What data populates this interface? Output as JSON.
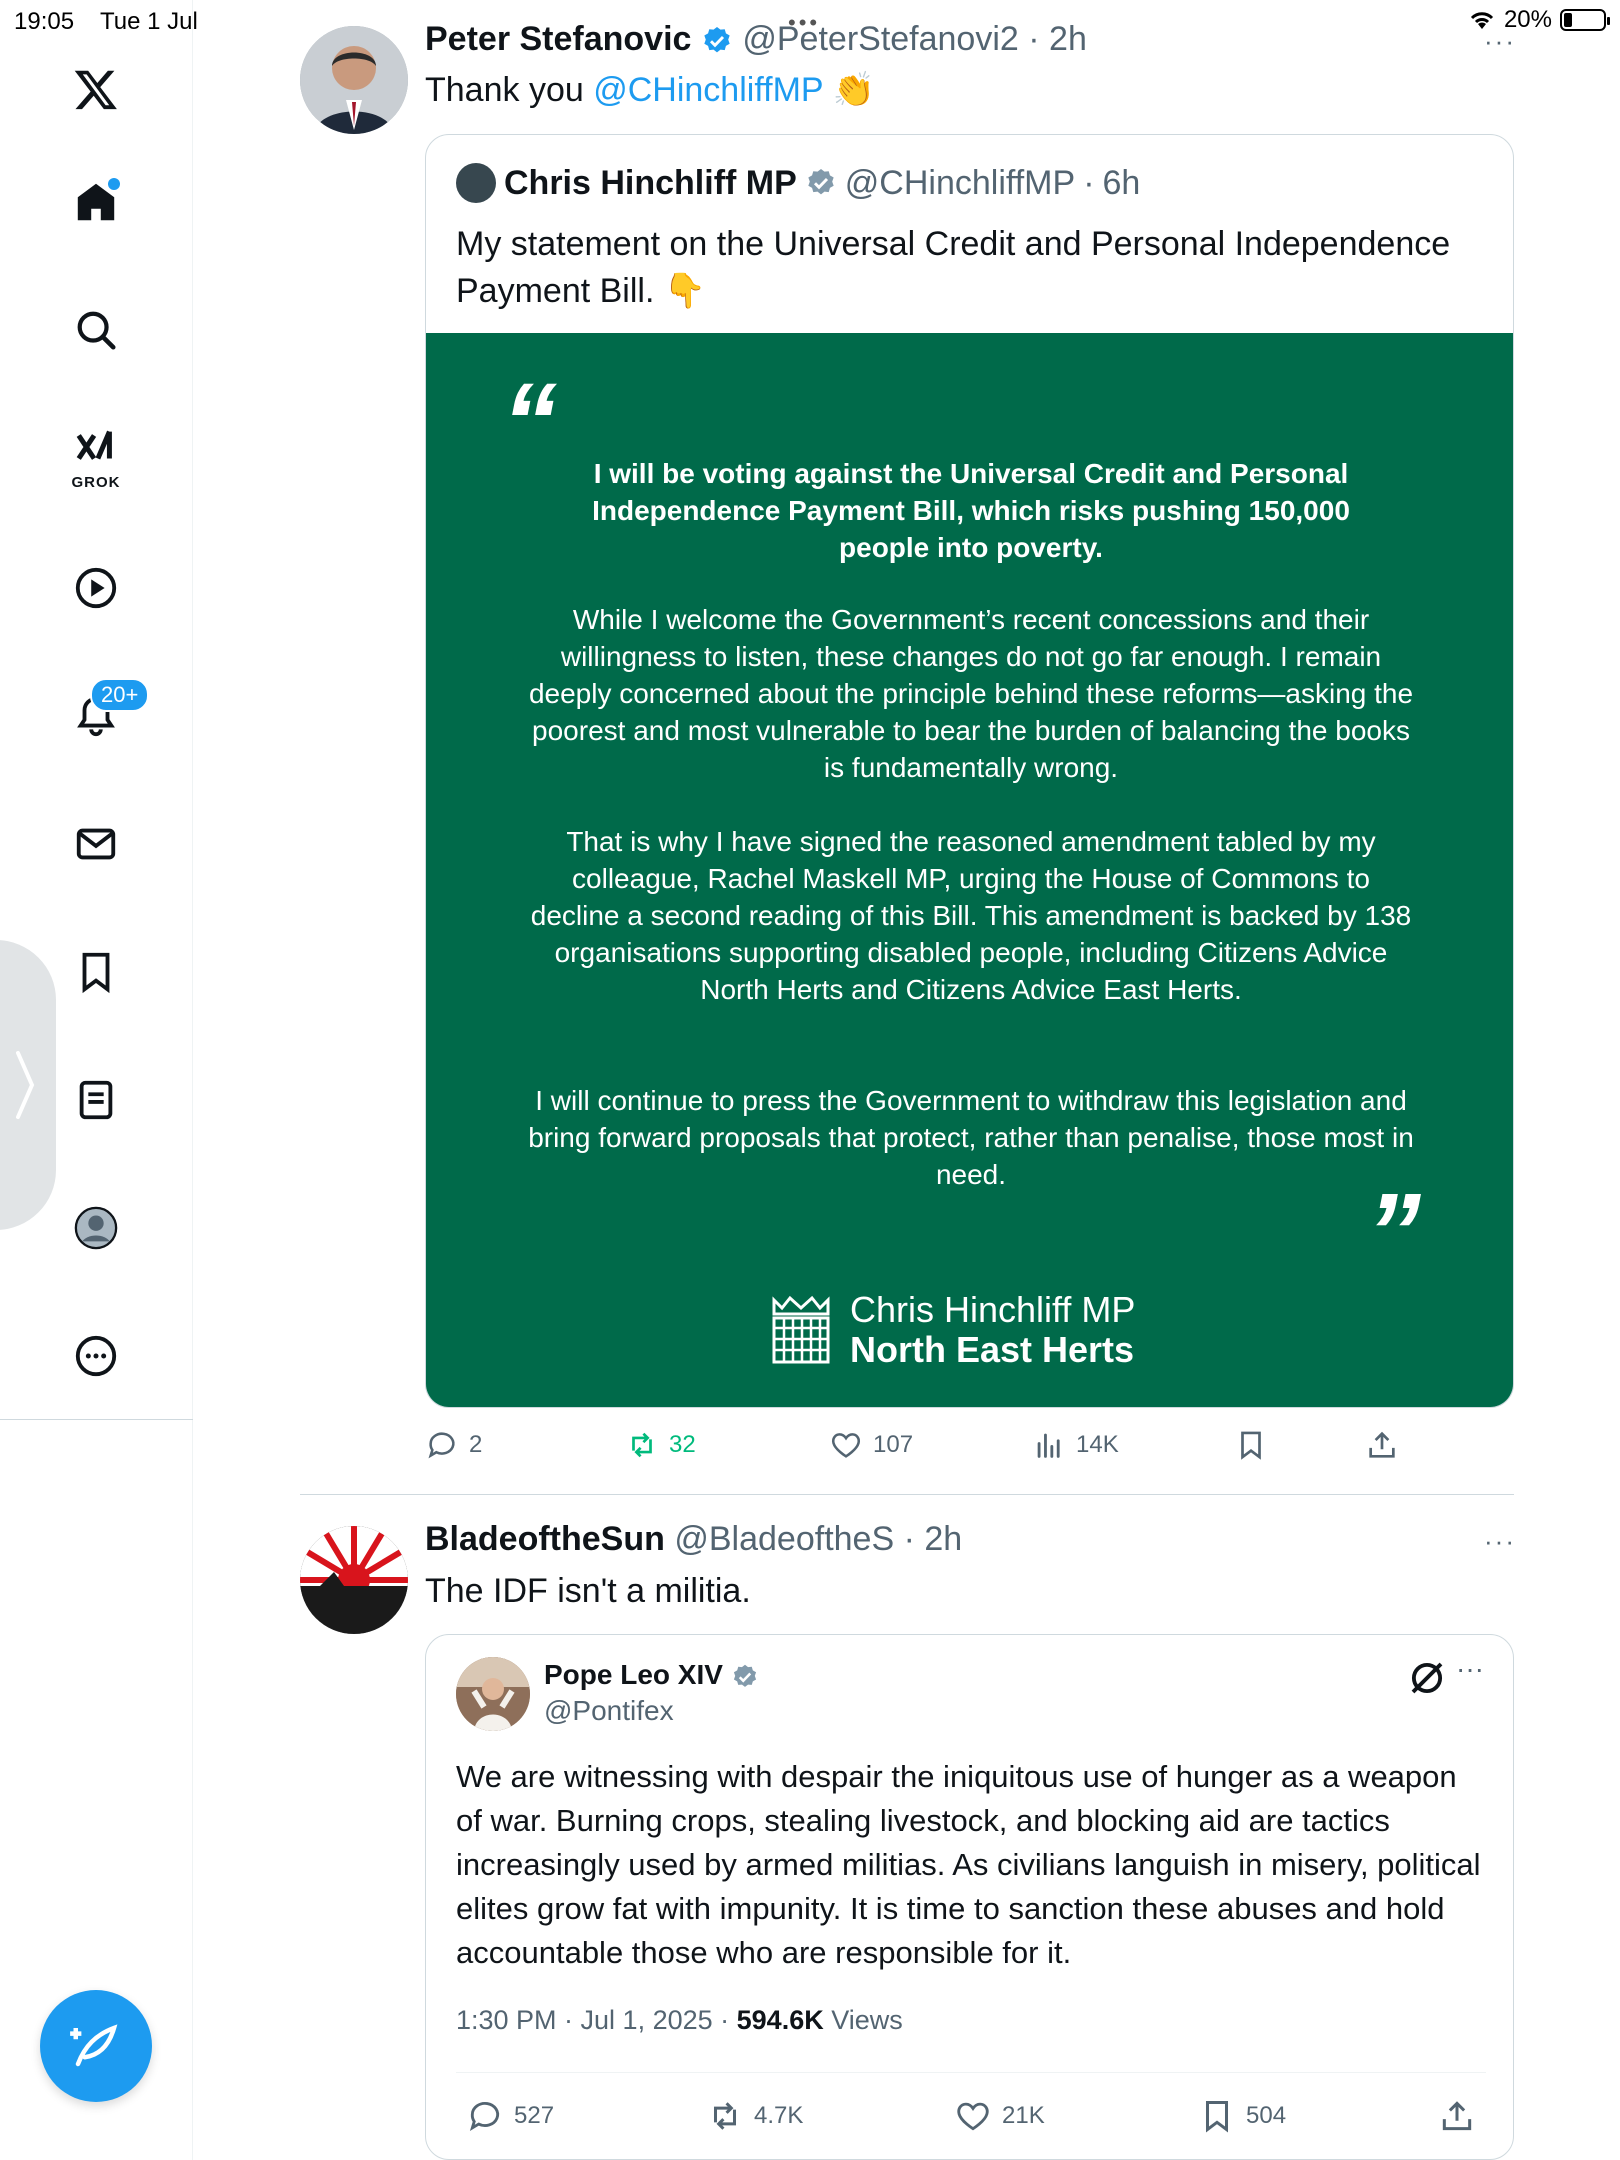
{
  "status_bar": {
    "time": "19:05",
    "date": "Tue 1 Jul",
    "battery": "20%",
    "battery_level": 0.2
  },
  "sidebar": {
    "notifications_badge": "20+",
    "grok_label": "GROK"
  },
  "tweet1": {
    "author_name": "Peter Stefanovic",
    "author_handle": "@PeterStefanovi2",
    "time": "2h",
    "text_prefix": "Thank you ",
    "mention": "@CHinchliffMP",
    "emoji": "👏",
    "quote": {
      "author_name": "Chris Hinchliff MP",
      "author_handle": "@CHinchliffMP",
      "time": "6h",
      "text": "My statement on the Universal Credit and Personal Independence Payment Bill. 👇",
      "image": {
        "lead": "I will be voting against the Universal Credit and Personal Independence Payment Bill, which risks pushing 150,000 people into poverty.",
        "p1": "While I welcome the Government’s recent concessions and their willingness to listen, these changes do not go far enough. I remain deeply concerned about the principle behind these reforms—asking the poorest and most vulnerable to bear the burden of balancing the books is fundamentally wrong.",
        "p2": "That is why I have signed the reasoned amendment tabled by my colleague, Rachel Maskell MP, urging the House of Commons to decline a second reading of this Bill. This amendment is backed by 138 organisations supporting disabled people, including Citizens Advice North Herts and Citizens Advice East Herts.",
        "p3": "I will continue to press the Government to withdraw this legislation and bring forward proposals that protect, rather than penalise, those most in need.",
        "open_quote": "“",
        "close_quote": "”",
        "signature_name": "Chris Hinchliff MP",
        "signature_seat": "North East Herts",
        "background_color": "#006a4a"
      }
    },
    "actions": {
      "replies": "2",
      "reposts": "32",
      "likes": "107",
      "views": "14K"
    }
  },
  "tweet2": {
    "author_name": "BladeoftheSun",
    "author_handle": "@BladeoftheS",
    "time": "2h",
    "text": "The IDF isn't a militia.",
    "quote": {
      "author_name": "Pope Leo XIV",
      "author_handle": "@Pontifex",
      "text": "We are witnessing with despair the iniquitous use of hunger as a weapon of war. Burning crops, stealing livestock, and blocking aid are tactics increasingly used by armed militias. As civilians languish in misery, political elites grow fat with impunity. It is time to sanction these abuses and hold accountable those who are responsible for it.",
      "timestamp": "1:30 PM · Jul 1, 2025 · ",
      "views_count": "594.6K",
      "views_label": " Views",
      "actions": {
        "replies": "527",
        "reposts": "4.7K",
        "likes": "21K",
        "bookmarks": "504"
      }
    }
  },
  "colors": {
    "accent": "#1d9bf0",
    "repost_active": "#00ba7c",
    "muted": "#536471"
  }
}
